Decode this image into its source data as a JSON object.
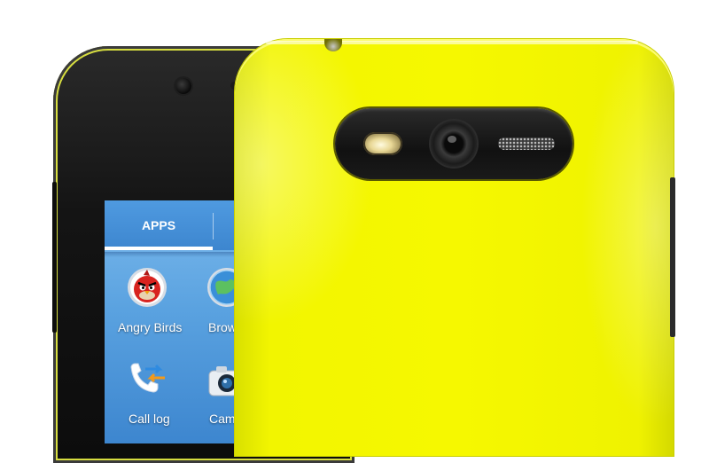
{
  "screen": {
    "tab_label": "APPS",
    "apps": [
      {
        "label": "Angry Birds",
        "icon": "angry-birds-icon"
      },
      {
        "label": "Brow",
        "icon": "browser-globe-icon"
      },
      {
        "label": "Call log",
        "icon": "call-log-icon"
      },
      {
        "label": "Cam",
        "icon": "camera-icon"
      }
    ]
  },
  "colors": {
    "back_cover": "#f4f700",
    "phone_body": "#141414",
    "screen_background": "#5aa2e0"
  }
}
